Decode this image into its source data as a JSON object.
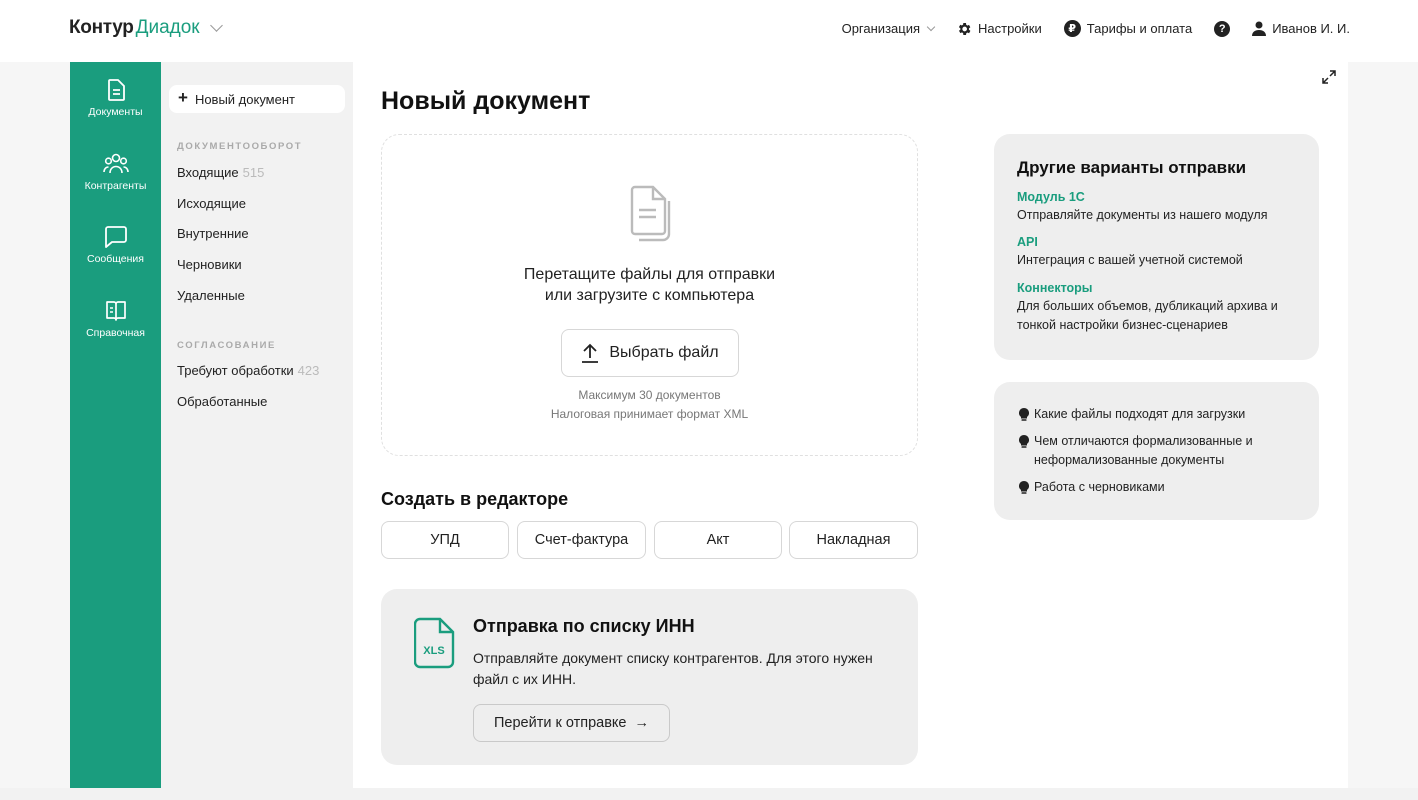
{
  "app": {
    "brand_a": "Контур",
    "brand_b": "Диадок"
  },
  "topnav": {
    "organization": "Организация",
    "settings": "Настройки",
    "ruble_glyph": "₽",
    "billing": "Тарифы и оплата",
    "help_glyph": "?",
    "user": "Иванов И. И."
  },
  "rail": {
    "items": [
      {
        "label": "Документы",
        "icon": "document-icon"
      },
      {
        "label": "Контрагенты",
        "icon": "people-icon"
      },
      {
        "label": "Сообщения",
        "icon": "message-icon"
      },
      {
        "label": "Справочная",
        "icon": "book-icon"
      }
    ]
  },
  "sidebar": {
    "new_doc_plus": "+",
    "new_doc": "Новый документ",
    "section1": "ДОКУМЕНТООБОРОТ",
    "items1": [
      {
        "label": "Входящие",
        "count": "515"
      },
      {
        "label": "Исходящие"
      },
      {
        "label": "Внутренние"
      },
      {
        "label": "Черновики"
      },
      {
        "label": "Удаленные"
      }
    ],
    "section2": "СОГЛАСОВАНИЕ",
    "items2": [
      {
        "label": "Требуют обработки",
        "count": "423"
      },
      {
        "label": "Обработанные"
      }
    ]
  },
  "main": {
    "title": "Новый документ",
    "drop": {
      "line1": "Перетащите файлы для отправки",
      "line2": "или загрузите с компьютера",
      "button": "Выбрать файл",
      "hint1": "Максимум 30 документов",
      "hint2": "Налоговая принимает формат XML"
    },
    "editor_title": "Создать в редакторе",
    "templates": [
      "УПД",
      "Счет-фактура",
      "Акт",
      "Накладная"
    ],
    "inn": {
      "title": "Отправка по списку ИНН",
      "desc": "Отправляйте документ списку контрагентов. Для этого нужен файл с их ИНН.",
      "button": "Перейти к отправке",
      "arrow": "→",
      "icon_text": "XLS"
    },
    "other": {
      "title": "Другие варианты отправки",
      "options": [
        {
          "name": "Модуль 1С",
          "desc": "Отправляйте документы из нашего модуля"
        },
        {
          "name": "API",
          "desc": "Интеграция с вашей учетной системой"
        },
        {
          "name": "Коннекторы",
          "desc": "Для больших объемов, дубликаций архива и тонкой настройки бизнес-сценариев"
        }
      ]
    },
    "tips": [
      "Какие файлы подходят для загрузки",
      "Чем отличаются формализованные и неформализованные документы",
      "Работа с черновиками"
    ]
  },
  "colors": {
    "accent": "#1a9d7e",
    "card": "#eeeeee",
    "sidebar": "#f2f2f2"
  }
}
